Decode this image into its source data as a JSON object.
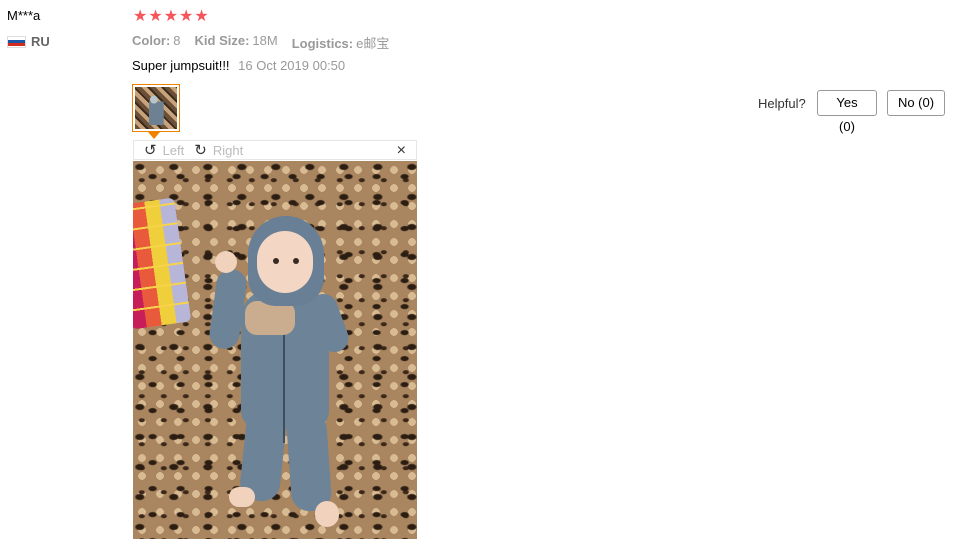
{
  "review": {
    "user_name": "M***a",
    "country_code": "RU",
    "rating": 5,
    "stars": [
      "★",
      "★",
      "★",
      "★",
      "★"
    ],
    "star_color": "#f5565c",
    "properties": [
      {
        "key": "Color:",
        "value": "8"
      },
      {
        "key": "Kid Size:",
        "value": "18M"
      },
      {
        "key": "Logistics:",
        "value": "e邮宝"
      }
    ],
    "comment": "Super jumpsuit!!!",
    "date": "16 Oct 2019 00:50",
    "thumbnail_border_color": "#f08200",
    "helpful_label": "Helpful?",
    "yes_label": "Yes (0)",
    "no_label": "No (0)"
  },
  "viewer": {
    "rotate_left_icon": "↺",
    "rotate_left_label": "Left",
    "rotate_right_icon": "↻",
    "rotate_right_label": "Right",
    "close_icon": "×"
  }
}
